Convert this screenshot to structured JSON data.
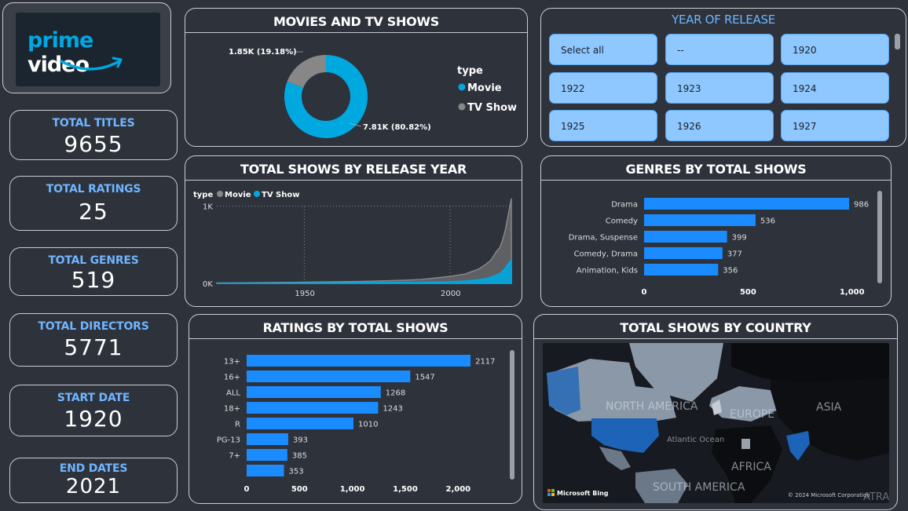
{
  "logo": {
    "line1": "prime",
    "line2": "video"
  },
  "kpis": [
    {
      "label": "TOTAL TITLES",
      "value": "9655"
    },
    {
      "label": "TOTAL RATINGS",
      "value": "25"
    },
    {
      "label": "TOTAL GENRES",
      "value": "519"
    },
    {
      "label": "TOTAL DIRECTORS",
      "value": "5771"
    },
    {
      "label": "START DATE",
      "value": "1920"
    },
    {
      "label": "END DATES",
      "value": "2021"
    }
  ],
  "panels": {
    "donut_title": "MOVIES AND TV SHOWS",
    "year_title": "YEAR OF RELEASE",
    "line_title": "TOTAL SHOWS BY RELEASE YEAR",
    "genre_title": "GENRES BY TOTAL SHOWS",
    "rating_title": "RATINGS BY TOTAL SHOWS",
    "map_title": "TOTAL SHOWS BY COUNTRY"
  },
  "slicer": {
    "options": [
      "Select all",
      "--",
      "1920",
      "1922",
      "1923",
      "1924",
      "1925",
      "1926",
      "1927"
    ]
  },
  "map": {
    "labels": [
      "NORTH AMERICA",
      "EUROPE",
      "ASIA",
      "AFRICA",
      "SOUTH AMERICA",
      "Atlantic Ocean",
      "ATRA"
    ],
    "attribution": "Microsoft Bing",
    "copyright": "© 2024 Microsoft Corporation"
  },
  "colors": {
    "accent": "#1a8cff",
    "movie": "#878787",
    "tv": "#00a8e0",
    "kpi_label": "#6fb5ff"
  },
  "chart_data": [
    {
      "type": "pie",
      "title": "MOVIES AND TV SHOWS",
      "legend_title": "type",
      "legend_position": "right",
      "categories": [
        "Movie",
        "TV Show"
      ],
      "values": [
        7810,
        1850
      ],
      "labels": [
        "7.81K (80.82%)",
        "1.85K (19.18%)"
      ],
      "colors": [
        "#00a8e0",
        "#878787"
      ]
    },
    {
      "type": "area",
      "title": "TOTAL SHOWS BY RELEASE YEAR",
      "legend_title": "type",
      "legend_position": "top-left",
      "x": [
        1920,
        1930,
        1940,
        1950,
        1960,
        1970,
        1980,
        1990,
        1995,
        2000,
        2005,
        2008,
        2010,
        2012,
        2014,
        2016,
        2017,
        2018,
        2019,
        2020,
        2021
      ],
      "series": [
        {
          "name": "Movie",
          "color": "#878787",
          "values": [
            5,
            8,
            12,
            15,
            20,
            25,
            35,
            50,
            70,
            90,
            120,
            160,
            190,
            240,
            300,
            420,
            460,
            560,
            700,
            900,
            1100
          ]
        },
        {
          "name": "TV Show",
          "color": "#00a8e0",
          "values": [
            0,
            2,
            3,
            5,
            8,
            10,
            12,
            15,
            18,
            22,
            30,
            40,
            50,
            60,
            80,
            110,
            130,
            160,
            200,
            260,
            300
          ]
        }
      ],
      "ylim": [
        0,
        1200
      ],
      "y_ticks": [
        0,
        1000
      ],
      "y_tick_labels": [
        "0K",
        "1K"
      ],
      "x_ticks": [
        1950,
        2000
      ],
      "x_tick_labels": [
        "1950",
        "2000"
      ],
      "xlim": [
        1920,
        2021
      ],
      "grid": true
    },
    {
      "type": "bar",
      "orientation": "horizontal",
      "title": "GENRES BY TOTAL SHOWS",
      "categories": [
        "Drama",
        "Comedy",
        "Drama, Suspense",
        "Comedy, Drama",
        "Animation, Kids"
      ],
      "values": [
        986,
        536,
        399,
        377,
        356
      ],
      "xlim": [
        0,
        1050
      ],
      "x_ticks": [
        0,
        500,
        1000
      ],
      "x_tick_labels": [
        "0",
        "500",
        "1,000"
      ],
      "color": "#1a8cff"
    },
    {
      "type": "bar",
      "orientation": "horizontal",
      "title": "RATINGS BY TOTAL SHOWS",
      "categories": [
        "13+",
        "16+",
        "ALL",
        "18+",
        "R",
        "PG-13",
        "7+",
        ""
      ],
      "values": [
        2117,
        1547,
        1268,
        1243,
        1010,
        393,
        385,
        353
      ],
      "xlim": [
        0,
        2250
      ],
      "x_ticks": [
        0,
        500,
        1000,
        1500,
        2000
      ],
      "x_tick_labels": [
        "0",
        "500",
        "1,000",
        "1,500",
        "2,000"
      ],
      "color": "#1a8cff"
    }
  ]
}
